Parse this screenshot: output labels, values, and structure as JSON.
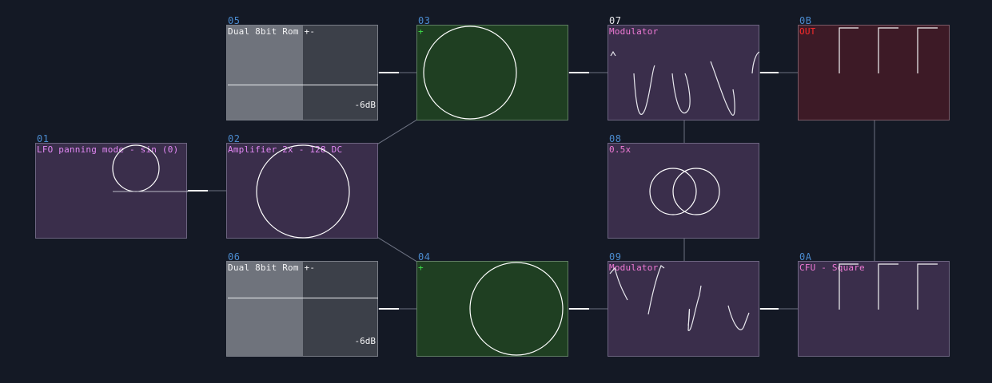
{
  "nodes": {
    "n01": {
      "id": "01",
      "label": "LFO panning mode - sin (0)"
    },
    "n02": {
      "id": "02",
      "label": "Amplifier 2x - 128 DC"
    },
    "n03": {
      "id": "03",
      "label": "+"
    },
    "n04": {
      "id": "04",
      "label": "+"
    },
    "n05": {
      "id": "05",
      "label": "Dual 8bit Rom +-",
      "level": "-6dB"
    },
    "n06": {
      "id": "06",
      "label": "Dual 8bit Rom +-",
      "level": "-6dB"
    },
    "n07": {
      "id": "07",
      "label": "Modulator"
    },
    "n08": {
      "id": "08",
      "label": "0.5x"
    },
    "n09": {
      "id": "09",
      "label": "Modulator"
    },
    "n0A": {
      "id": "0A",
      "label": "CFU - Square"
    },
    "n0B": {
      "id": "0B",
      "label": "OUT"
    }
  },
  "colors": {
    "background": "#141925",
    "id_label": "#4b8bcf",
    "title_pink": "#e288f4",
    "out_red": "#ff2a2a",
    "plus_green": "#3ee04a"
  }
}
